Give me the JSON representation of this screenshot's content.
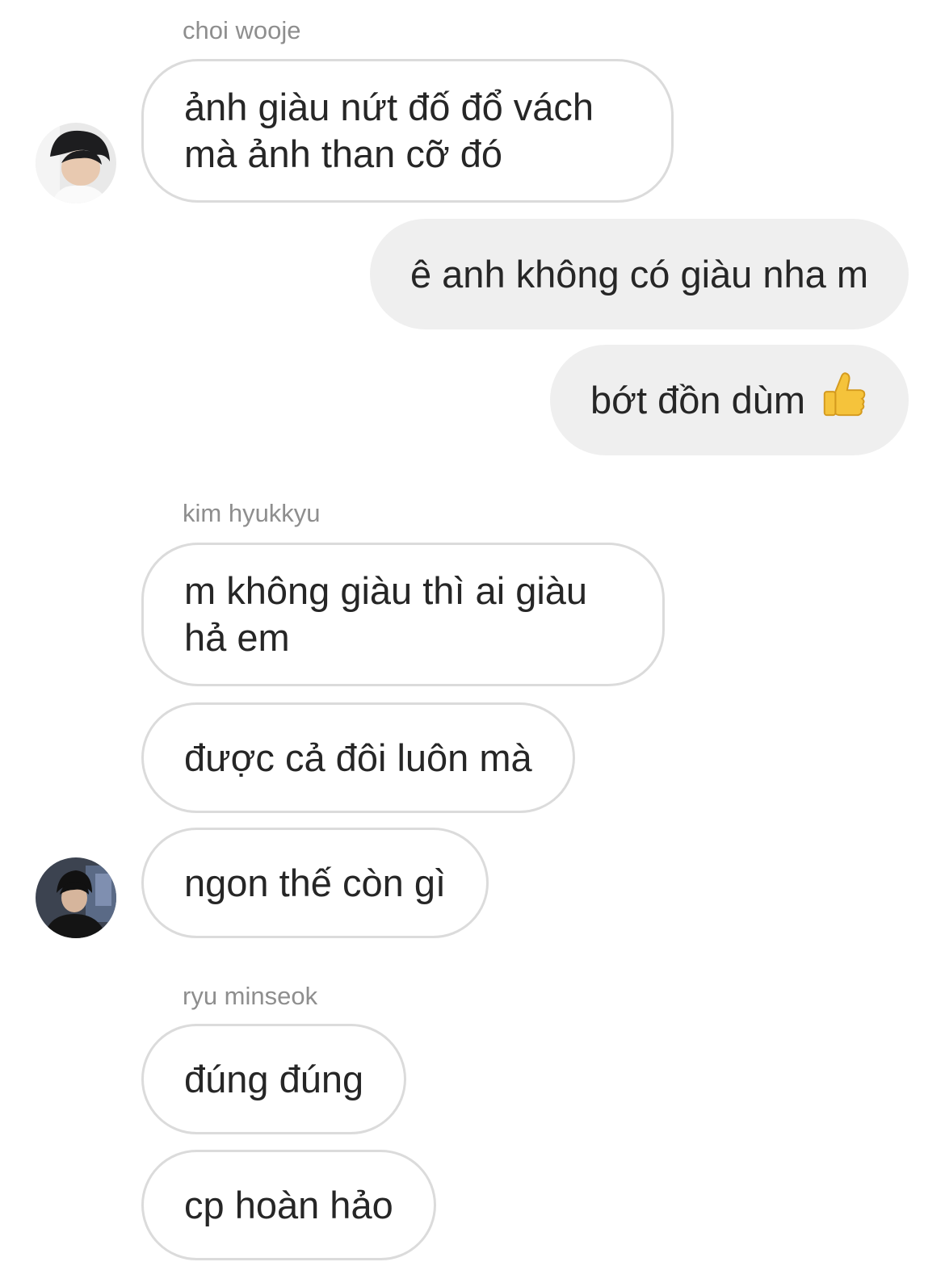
{
  "thread": {
    "groups": [
      {
        "sender": "choi wooje",
        "messages": [
          "ảnh giàu nứt đố đổ vách mà ảnh than cỡ đó"
        ]
      },
      {
        "sender": "",
        "messages": [
          "ê anh không có giàu nha m",
          "bớt đồn dùm"
        ]
      },
      {
        "sender": "kim hyukkyu",
        "messages": [
          "m không giàu thì ai giàu hả em",
          "được cả đôi luôn mà",
          "ngon thế còn gì"
        ]
      },
      {
        "sender": "ryu minseok",
        "messages": [
          "đúng đúng",
          "cp hoàn hảo"
        ]
      }
    ]
  },
  "emoji": {
    "thumbs_up": "thumbs-up-icon"
  },
  "colors": {
    "incoming_border": "#dbdbdb",
    "outgoing_bg": "#efefef",
    "sender_label": "#8e8e8e",
    "text": "#262626",
    "thumb_fill": "#f5c33b"
  }
}
